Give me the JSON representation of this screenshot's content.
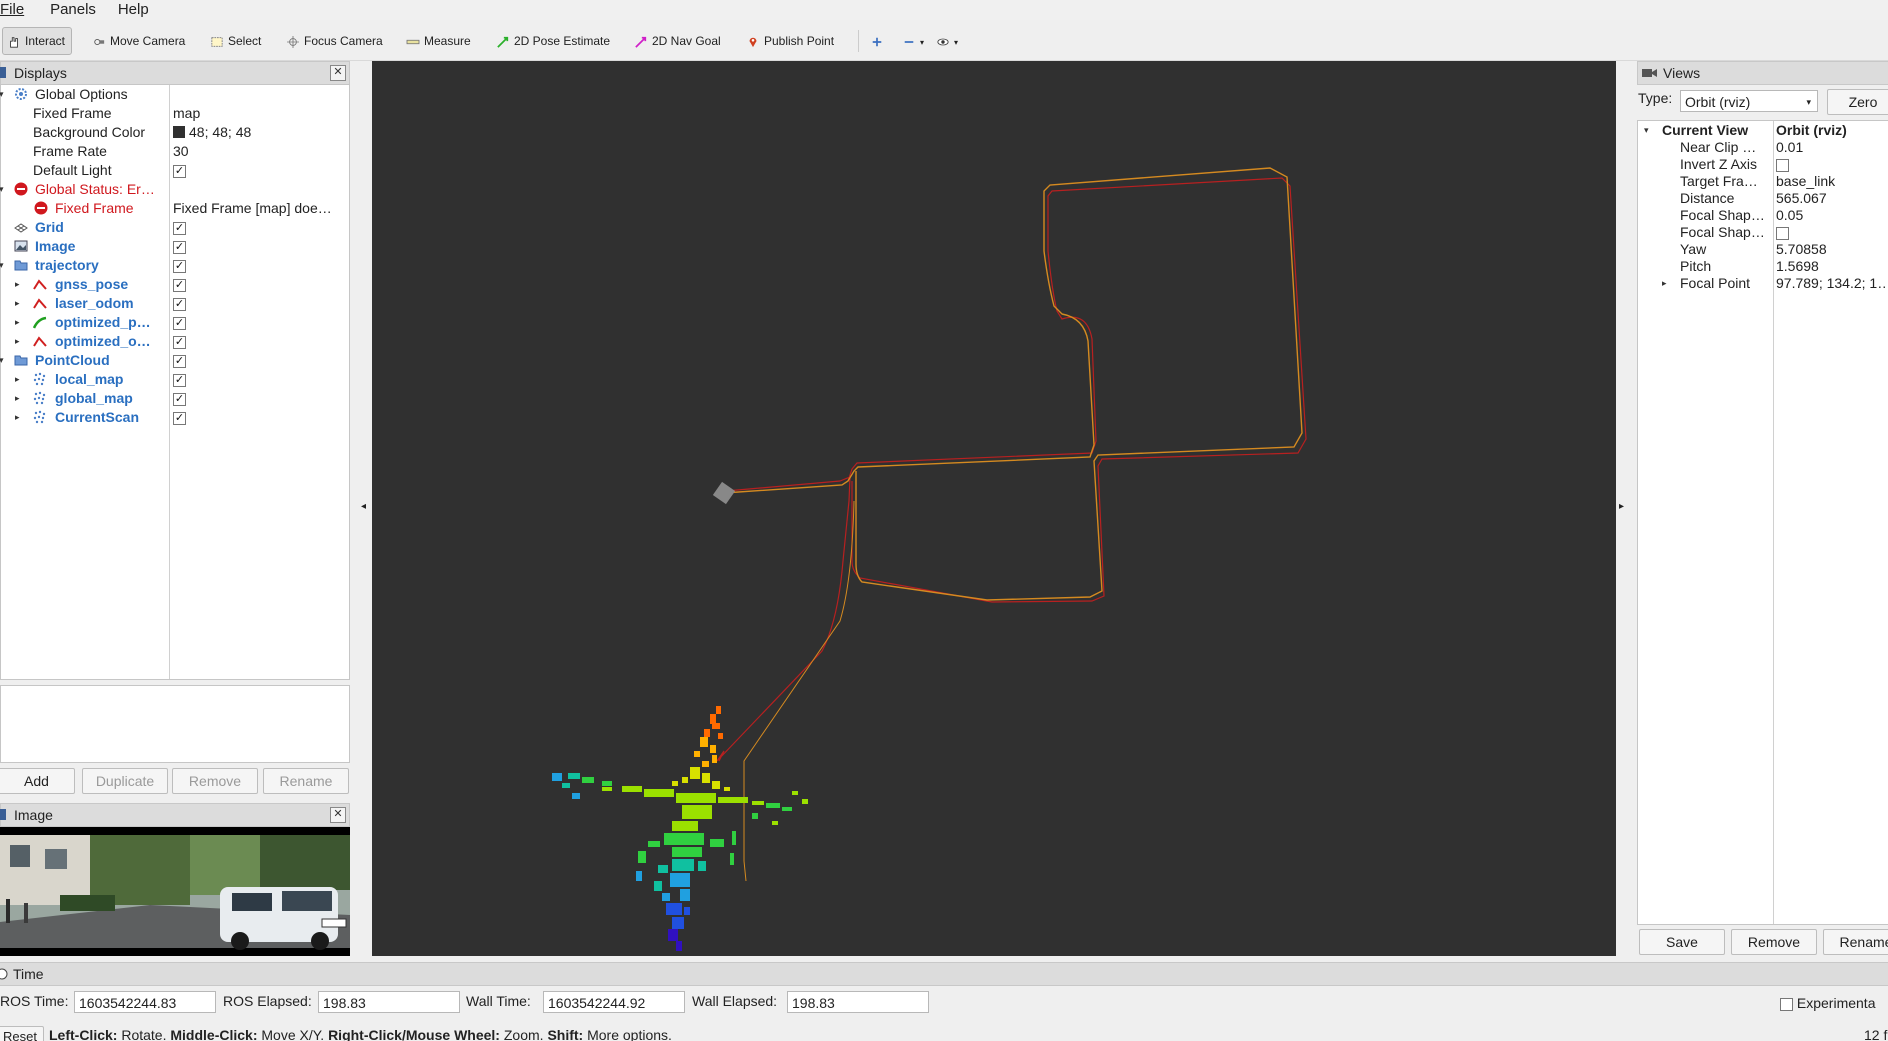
{
  "menu": [
    "File",
    "Panels",
    "Help"
  ],
  "toolbar": {
    "interact": "Interact",
    "move_camera": "Move Camera",
    "select": "Select",
    "focus_camera": "Focus Camera",
    "measure": "Measure",
    "pose_estimate": "2D Pose Estimate",
    "nav_goal": "2D Nav Goal",
    "publish_point": "Publish Point"
  },
  "displays": {
    "title": "Displays",
    "global_options": "Global Options",
    "fixed_frame_label": "Fixed Frame",
    "fixed_frame_value": "map",
    "background_color_label": "Background Color",
    "background_color_value": "48; 48; 48",
    "frame_rate_label": "Frame Rate",
    "frame_rate_value": "30",
    "default_light_label": "Default Light",
    "global_status": "Global Status: Er…",
    "status_fixed_frame": "Fixed Frame",
    "status_fixed_frame_msg": "Fixed Frame [map] doe…",
    "grid": "Grid",
    "image": "Image",
    "trajectory": "trajectory",
    "gnss_pose": "gnss_pose",
    "laser_odom": "laser_odom",
    "optimized_p": "optimized_p…",
    "optimized_o": "optimized_o…",
    "pointcloud": "PointCloud",
    "local_map": "local_map",
    "global_map": "global_map",
    "current_scan": "CurrentScan",
    "buttons": {
      "add": "Add",
      "duplicate": "Duplicate",
      "remove": "Remove",
      "rename": "Rename"
    }
  },
  "image_panel": {
    "title": "Image"
  },
  "views": {
    "title": "Views",
    "type_label": "Type:",
    "type_value": "Orbit (rviz)",
    "zero": "Zero",
    "current_view": "Current View",
    "current_view_value": "Orbit (rviz)",
    "props": [
      {
        "k": "Near Clip …",
        "v": "0.01"
      },
      {
        "k": "Invert Z Axis",
        "v": ""
      },
      {
        "k": "Target Fra…",
        "v": "base_link"
      },
      {
        "k": "Distance",
        "v": "565.067"
      },
      {
        "k": "Focal Shap…",
        "v": "0.05"
      },
      {
        "k": "Focal Shap…",
        "v": ""
      },
      {
        "k": "Yaw",
        "v": "5.70858"
      },
      {
        "k": "Pitch",
        "v": "1.5698"
      },
      {
        "k": "Focal Point",
        "v": "97.789; 134.2; 1…"
      }
    ],
    "buttons": {
      "save": "Save",
      "remove": "Remove",
      "rename": "Rename"
    }
  },
  "time": {
    "title": "Time",
    "ros_time_label": "ROS Time:",
    "ros_time": "1603542244.83",
    "ros_elapsed_label": "ROS Elapsed:",
    "ros_elapsed": "198.83",
    "wall_time_label": "Wall Time:",
    "wall_time": "1603542244.92",
    "wall_elapsed_label": "Wall Elapsed:",
    "wall_elapsed": "198.83",
    "experimental": "Experimenta"
  },
  "status_bar": {
    "reset": "Reset",
    "hint_left_click": "Left-Click:",
    "hint_rotate": "Rotate.",
    "hint_middle_click": "Middle-Click:",
    "hint_move": "Move X/Y.",
    "hint_right_click": "Right-Click/Mouse Wheel:",
    "hint_zoom": "Zoom.",
    "hint_shift": "Shift:",
    "hint_more": "More options.",
    "fps": "12 f"
  },
  "colors": {
    "viewport_bg": "#303030",
    "error": "#d0181e",
    "display_name": "#2a6fc0"
  }
}
